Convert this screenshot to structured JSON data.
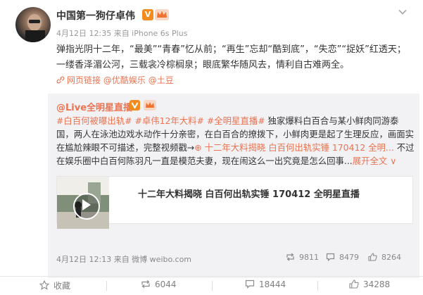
{
  "post": {
    "username": "中国第一狗仔卓伟",
    "verified_badge": "V",
    "meta": "4月12日 12:35 来自 iPhone 6s Plus",
    "text": "弹指光阴十二年，“最美”“青春”忆从前；“再生”忘却“酷到底”，“失恋”“捉妖”红透天；一缕香泽湄公河，三载衾冷棕榈泉；眼底繁华随风去，情利自古难两全。",
    "links": {
      "web_link": "网页链接",
      "mention_1": "@优酷娱乐",
      "mention_2": "@土豆"
    }
  },
  "repost": {
    "author": "@Live全明星直播",
    "segments": [
      {
        "text": "#白百何被曝出轨#",
        "kind": "tag"
      },
      {
        "text": " ",
        "kind": "plain"
      },
      {
        "text": "#卓伟12年大料#",
        "kind": "tag"
      },
      {
        "text": " ",
        "kind": "plain"
      },
      {
        "text": "#全明星直播#",
        "kind": "tag"
      },
      {
        "text": " 独家爆料白百合与某小鲜肉同游泰国，两人在泳池边戏水动作十分亲密，在白百合的撩拨下，小鲜肉更是起了生理反应，画面实在尴尬辣眼不可描述，完整视频戳→",
        "kind": "plain"
      },
      {
        "text": "⊕ 十二年大料揭晓 白百何出轨实锤 170412 全明...",
        "kind": "link"
      },
      {
        "text": " 不过在娱乐圈中白百何陈羽凡一直是模范夫妻，现在闹这么一出究竟是怎么回事...",
        "kind": "plain"
      },
      {
        "text": "展开全文 ∨",
        "kind": "link"
      }
    ],
    "card_title": "十二年大料揭晓 白百何出轨实锤 170412 全明星直播",
    "footer": "4月12日 12:13 来自 微博 weibo.com",
    "stats": {
      "reposts": "9811",
      "comments": "8479",
      "likes": "8264"
    }
  },
  "actions": {
    "favorite": "收藏",
    "repost": "6044",
    "comment": "18444",
    "like": "34288"
  },
  "colors": {
    "accent": "#eb7350",
    "badge": "#f28c1f",
    "repost_bg": "#f2f2f5"
  },
  "icons": [
    "avatar",
    "verified-icon",
    "crown-icon",
    "chevron-down-icon",
    "link-icon",
    "play-icon",
    "repost-icon",
    "comment-icon",
    "like-icon",
    "favorite-icon"
  ]
}
